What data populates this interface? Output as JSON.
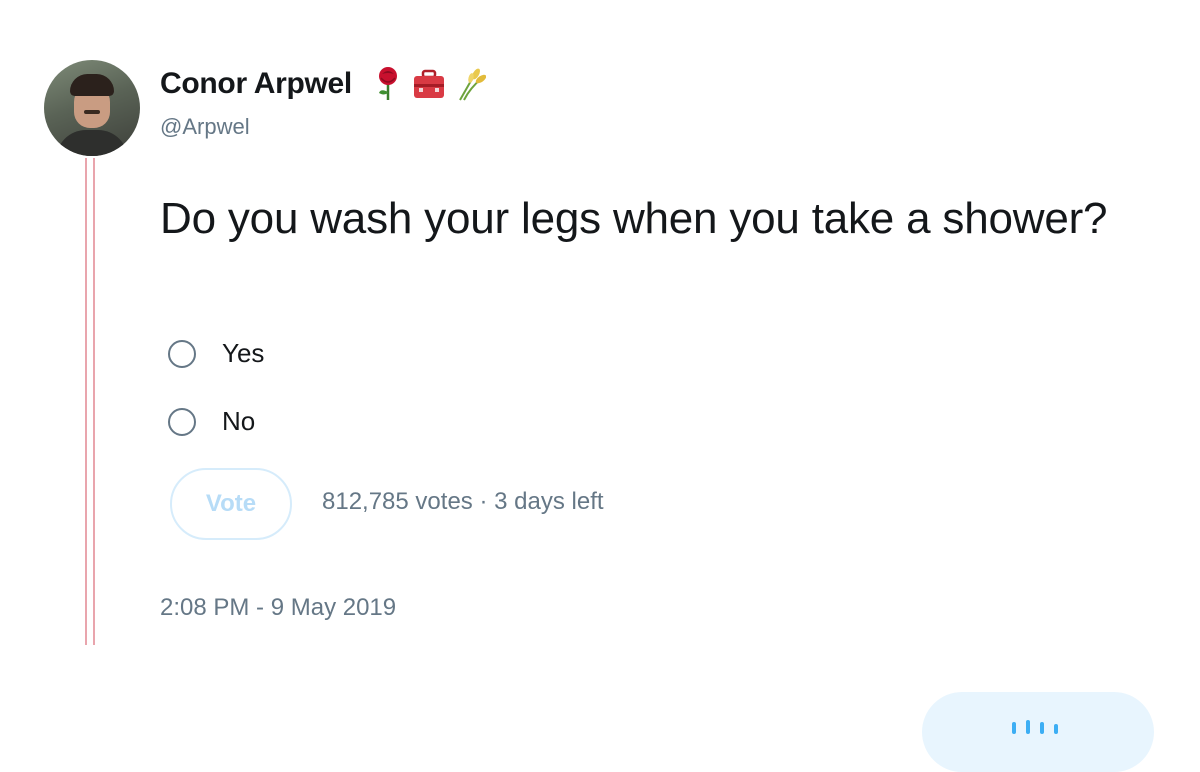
{
  "author": {
    "display_name": "Conor Arpwel",
    "handle": "@Arpwel",
    "emojis": [
      "rose-emoji",
      "toolbox-emoji",
      "sheaf-of-rice-emoji"
    ]
  },
  "tweet": {
    "text": "Do you wash your legs when you take a shower?",
    "timestamp": "2:08 PM - 9 May 2019"
  },
  "poll": {
    "options": [
      {
        "label": "Yes"
      },
      {
        "label": "No"
      }
    ],
    "vote_label": "Vote",
    "votes": "812,785 votes",
    "separator": "·",
    "time_left": "3 days left"
  },
  "colors": {
    "secondary_text": "#657786",
    "thread_line": "#e9a5ad",
    "vote_disabled": "#b7dcf7",
    "accent": "#1da1f2"
  }
}
